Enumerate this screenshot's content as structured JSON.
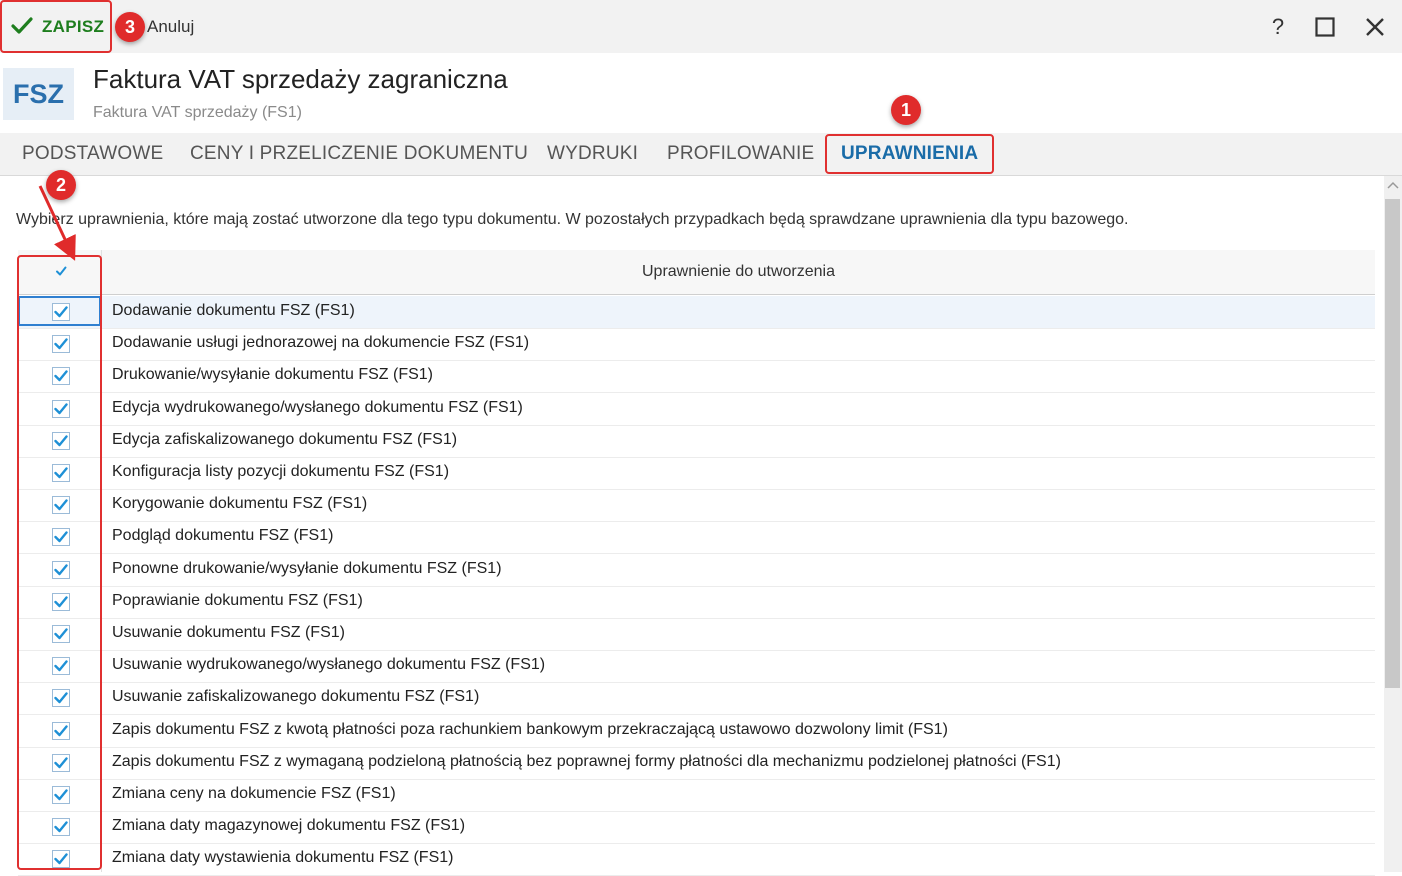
{
  "toolbar": {
    "save_label": "ZAPISZ",
    "cancel_label": "Anuluj",
    "help_label": "?"
  },
  "header": {
    "badge": "FSZ",
    "title": "Faktura VAT sprzedaży zagraniczna",
    "subtitle": "Faktura VAT sprzedaży (FS1)"
  },
  "tabs": [
    {
      "label": "PODSTAWOWE"
    },
    {
      "label": "CENY I PRZELICZENIE DOKUMENTU"
    },
    {
      "label": "WYDRUKI"
    },
    {
      "label": "PROFILOWANIE"
    },
    {
      "label": "UPRAWNIENIA",
      "active": true
    }
  ],
  "description": "Wybierz uprawnienia, które mają zostać utworzone dla tego typu dokumentu. W pozostałych przypadkach będą sprawdzane uprawnienia dla typu bazowego.",
  "grid": {
    "column_header": "Uprawnienie do utworzenia",
    "rows": [
      {
        "label": "Dodawanie dokumentu FSZ (FS1)",
        "checked": true
      },
      {
        "label": "Dodawanie usługi jednorazowej na dokumencie FSZ (FS1)",
        "checked": true
      },
      {
        "label": "Drukowanie/wysyłanie dokumentu FSZ (FS1)",
        "checked": true
      },
      {
        "label": "Edycja wydrukowanego/wysłanego dokumentu FSZ (FS1)",
        "checked": true
      },
      {
        "label": "Edycja zafiskalizowanego dokumentu FSZ (FS1)",
        "checked": true
      },
      {
        "label": "Konfiguracja listy pozycji dokumentu FSZ (FS1)",
        "checked": true
      },
      {
        "label": "Korygowanie dokumentu FSZ (FS1)",
        "checked": true
      },
      {
        "label": "Podgląd dokumentu FSZ (FS1)",
        "checked": true
      },
      {
        "label": "Ponowne drukowanie/wysyłanie dokumentu FSZ (FS1)",
        "checked": true
      },
      {
        "label": "Poprawianie dokumentu FSZ (FS1)",
        "checked": true
      },
      {
        "label": "Usuwanie dokumentu FSZ (FS1)",
        "checked": true
      },
      {
        "label": "Usuwanie wydrukowanego/wysłanego dokumentu FSZ (FS1)",
        "checked": true
      },
      {
        "label": "Usuwanie zafiskalizowanego dokumentu FSZ (FS1)",
        "checked": true
      },
      {
        "label": "Zapis dokumentu FSZ z kwotą płatności poza rachunkiem bankowym przekraczającą ustawowo dozwolony limit (FS1)",
        "checked": true
      },
      {
        "label": "Zapis dokumentu FSZ z wymaganą podzieloną płatnością bez poprawnej formy płatności dla mechanizmu podzielonej płatności (FS1)",
        "checked": true
      },
      {
        "label": "Zmiana ceny na dokumencie FSZ (FS1)",
        "checked": true
      },
      {
        "label": "Zmiana daty magazynowej dokumentu FSZ (FS1)",
        "checked": true
      },
      {
        "label": "Zmiana daty wystawienia dokumentu FSZ (FS1)",
        "checked": true
      }
    ]
  },
  "annotations": [
    {
      "label": "1"
    },
    {
      "label": "2"
    },
    {
      "label": "3"
    }
  ],
  "colors": {
    "accent": "#1a6ca8",
    "save_green": "#1e7e1e",
    "annotation_red": "#e02b2b",
    "checkmark": "#1e90d6"
  }
}
